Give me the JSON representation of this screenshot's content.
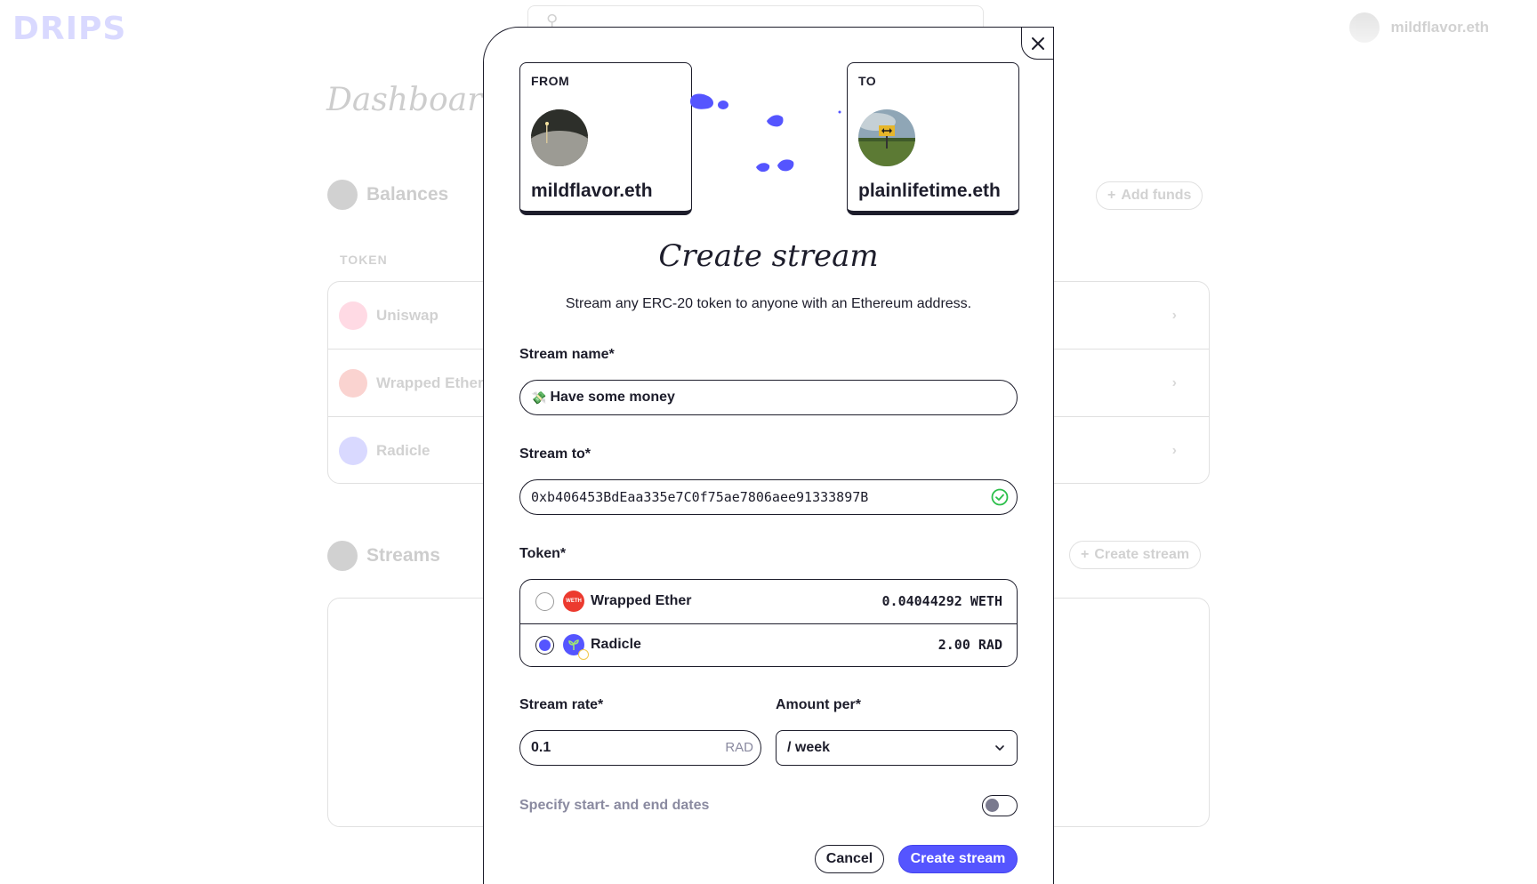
{
  "background": {
    "logo": "DRIPS",
    "user_name": "mildflavor.eth",
    "dashboard_title": "Dashboard",
    "balances_title": "Balances",
    "add_funds_label": "Add funds",
    "token_column": "TOKEN",
    "tokens": [
      {
        "name": "Uniswap",
        "color": "#ff5a8a"
      },
      {
        "name": "Wrapped Ether",
        "color": "#ec3a2f"
      },
      {
        "name": "Radicle",
        "color": "#5555ff"
      }
    ],
    "streams_title": "Streams",
    "create_stream_label": "Create stream"
  },
  "modal": {
    "from": {
      "label": "FROM",
      "name": "mildflavor.eth"
    },
    "to": {
      "label": "TO",
      "name": "plainlifetime.eth"
    },
    "title": "Create stream",
    "subtitle": "Stream any ERC-20 token to anyone with an Ethereum address.",
    "stream_name": {
      "label": "Stream name*",
      "emoji": "💸",
      "value": "Have some money"
    },
    "stream_to": {
      "label": "Stream to*",
      "value": "0xb406453BdEaa335e7C0f75ae7806aee91333897B",
      "valid": true
    },
    "token": {
      "label": "Token*",
      "options": [
        {
          "name": "Wrapped Ether",
          "balance": "0.04044292 WETH",
          "icon_text": "WETH",
          "selected": false
        },
        {
          "name": "Radicle",
          "balance": "2.00 RAD",
          "icon_text": "",
          "selected": true
        }
      ]
    },
    "stream_rate": {
      "label": "Stream rate*",
      "value": "0.1",
      "unit": "RAD"
    },
    "amount_per": {
      "label": "Amount per*",
      "value": "/ week"
    },
    "dates_toggle": {
      "label": "Specify start- and end dates",
      "enabled": false
    },
    "buttons": {
      "cancel": "Cancel",
      "create": "Create stream"
    }
  },
  "colors": {
    "accent": "#5555ff",
    "ink": "#1d1d2b",
    "success": "#2bbf4a",
    "muted": "#8a8aa0"
  }
}
